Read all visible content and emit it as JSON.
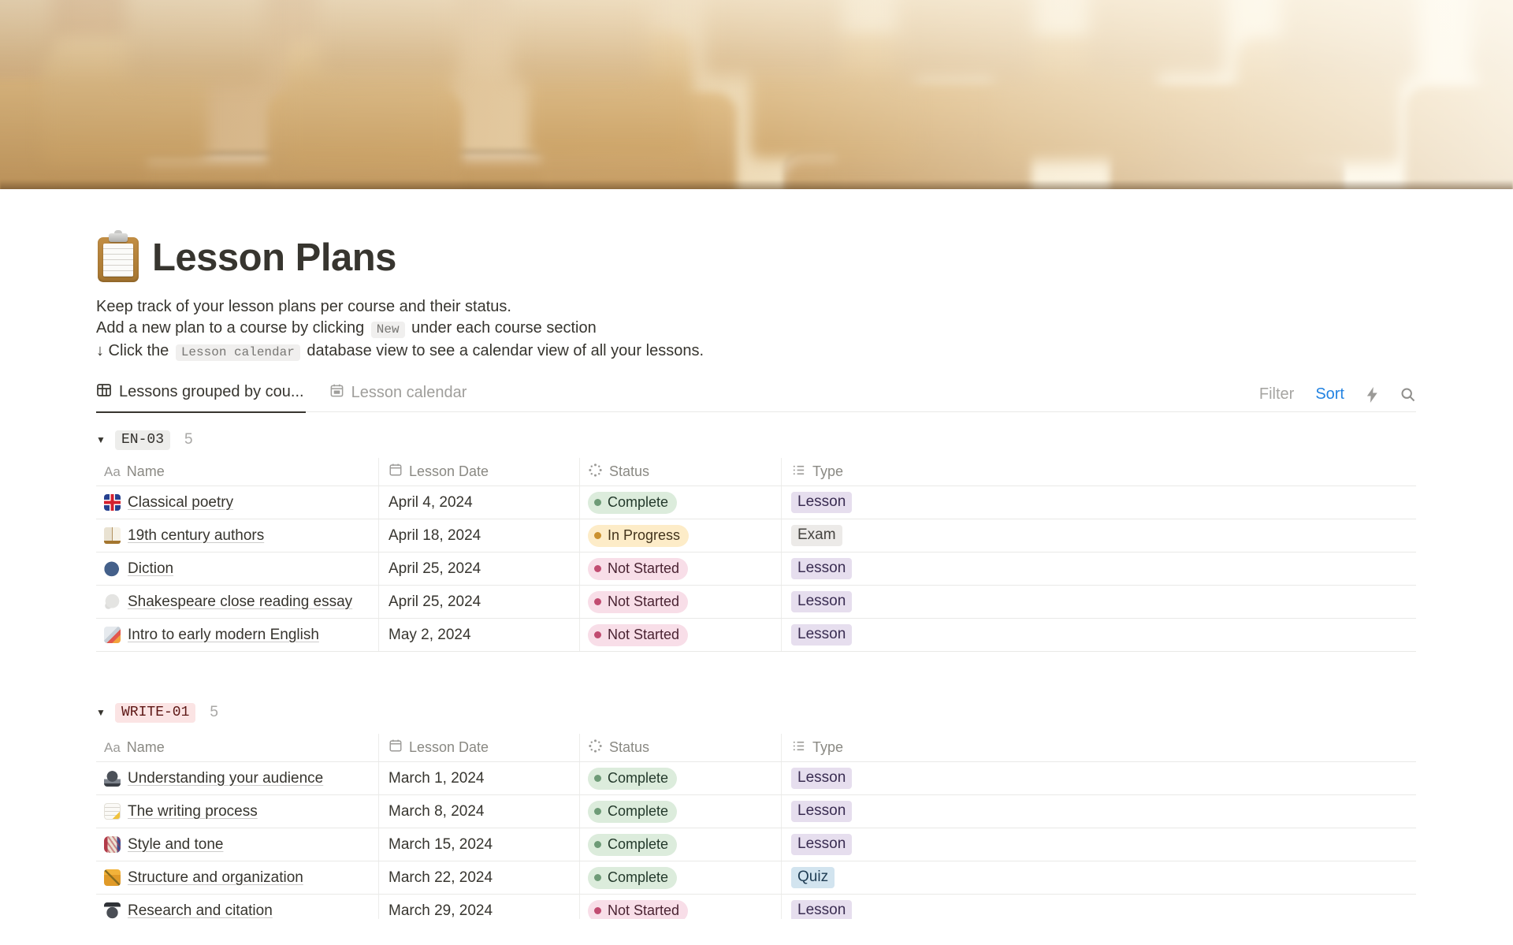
{
  "page": {
    "icon": "clipboard",
    "title": "Lesson Plans",
    "description": {
      "line1": "Keep track of your lesson plans per course and their status.",
      "line2_prefix": "Add a new plan to a course by clicking ",
      "line2_code": "New",
      "line2_suffix": " under each course section",
      "line3_prefix": "↓ Click the ",
      "line3_code": "Lesson calendar",
      "line3_suffix": " database view to see a calendar view of all your lessons."
    }
  },
  "tabs": [
    {
      "icon": "table-icon",
      "label": "Lessons grouped by cou...",
      "active": true
    },
    {
      "icon": "calendar-icon",
      "label": "Lesson calendar",
      "active": false
    }
  ],
  "toolbar": {
    "filter": "Filter",
    "sort": "Sort",
    "icons": [
      "lightning-icon",
      "search-icon"
    ]
  },
  "columns": [
    {
      "icon": "text-icon",
      "label": "Name"
    },
    {
      "icon": "calendar-icon",
      "label": "Lesson Date"
    },
    {
      "icon": "status-spinner-icon",
      "label": "Status"
    },
    {
      "icon": "list-icon",
      "label": "Type"
    }
  ],
  "groups": [
    {
      "id": "EN-03",
      "count": "5",
      "color": "gray",
      "rows": [
        {
          "emoji": "🇬🇧",
          "emoji_icon": "uk-flag-icon",
          "name": "Classical poetry",
          "date": "April 4, 2024",
          "status": "Complete",
          "type": "Lesson"
        },
        {
          "emoji": "📖",
          "emoji_icon": "open-book-icon",
          "name": "19th century authors",
          "date": "April 18, 2024",
          "status": "In Progress",
          "type": "Exam"
        },
        {
          "emoji": "🗣️",
          "emoji_icon": "speaking-head-icon",
          "name": "Diction",
          "date": "April 25, 2024",
          "status": "Not Started",
          "type": "Lesson"
        },
        {
          "emoji": "💭",
          "emoji_icon": "thought-balloon-icon",
          "name": "Shakespeare close reading essay",
          "date": "April 25, 2024",
          "status": "Not Started",
          "type": "Lesson"
        },
        {
          "emoji": "🚀",
          "emoji_icon": "rocket-icon",
          "name": "Intro to early modern English",
          "date": "May 2, 2024",
          "status": "Not Started",
          "type": "Lesson"
        }
      ]
    },
    {
      "id": "WRITE-01",
      "count": "5",
      "color": "red",
      "rows": [
        {
          "emoji": "🎙️",
          "emoji_icon": "microphone-icon",
          "name": "Understanding your audience",
          "date": "March 1, 2024",
          "status": "Complete",
          "type": "Lesson"
        },
        {
          "emoji": "📝",
          "emoji_icon": "memo-icon",
          "name": "The writing process",
          "date": "March 8, 2024",
          "status": "Complete",
          "type": "Lesson"
        },
        {
          "emoji": "🧵",
          "emoji_icon": "thread-icon",
          "name": "Style and tone",
          "date": "March 15, 2024",
          "status": "Complete",
          "type": "Lesson"
        },
        {
          "emoji": "🏗️",
          "emoji_icon": "crane-icon",
          "name": "Structure and organization",
          "date": "March 22, 2024",
          "status": "Complete",
          "type": "Quiz"
        },
        {
          "emoji": "🕵️",
          "emoji_icon": "detective-icon",
          "name": "Research and citation",
          "date": "March 29, 2024",
          "status": "Not Started",
          "type": "Lesson"
        }
      ]
    }
  ],
  "colors": {
    "accent_blue": "#2383e2",
    "status_complete_bg": "#dcecdc",
    "status_complete_dot": "#6e9b77",
    "status_inprogress_bg": "#fdecc8",
    "status_inprogress_dot": "#cb912f",
    "status_notstarted_bg": "#f8dee8",
    "status_notstarted_dot": "#c14c71",
    "type_lesson_bg": "#e6deee",
    "type_exam_bg": "#eceae8",
    "type_quiz_bg": "#d2e4ef",
    "group_red_bg": "#fbe4e4",
    "group_gray_bg": "#ededeb"
  }
}
